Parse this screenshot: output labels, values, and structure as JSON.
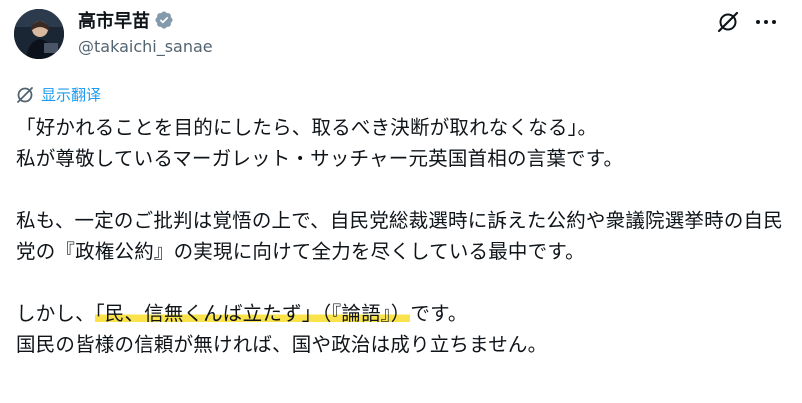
{
  "author": {
    "display_name": "高市早苗",
    "handle": "@takaichi_sanae",
    "verified": true
  },
  "actions": {
    "grok_icon": "grok-icon",
    "more_icon": "more-icon"
  },
  "translate": {
    "label": "显示翻译",
    "icon": "globe-icon"
  },
  "tweet": {
    "p1_line1": "「好かれることを目的にしたら、取るべき決断が取れなくなる」。",
    "p1_line2": "私が尊敬しているマーガレット・サッチャー元英国首相の言葉です。",
    "p2": "私も、一定のご批判は覚悟の上で、自民党総裁選時に訴えた公約や衆議院選挙時の自民党の『政権公約』の実現に向けて全力を尽くしている最中です。",
    "p3_prefix": "しかし、",
    "p3_highlight": "「民、信無くんば立たず」（『論語』）",
    "p3_suffix": "です。",
    "p3_line2": "国民の皆様の信頼が無ければ、国や政治は成り立ちません。"
  },
  "colors": {
    "link": "#1d9bf0",
    "verified_badge": "#829aab",
    "highlight": "#f9e24a",
    "secondary_text": "#536471"
  }
}
